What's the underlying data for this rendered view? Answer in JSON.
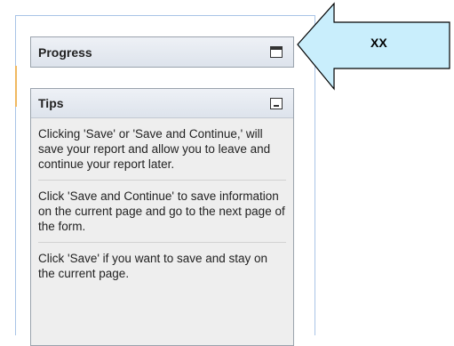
{
  "progress_panel": {
    "title": "Progress",
    "button_icon": "maximize-icon"
  },
  "tips_panel": {
    "title": "Tips",
    "button_icon": "minimize-icon",
    "tips": [
      "Clicking 'Save' or 'Save and Continue,' will save your report and allow you to leave and continue your report later.",
      "Click 'Save and Continue' to save information on the current page and go to the next page of the form.",
      "Click 'Save' if you want to save and stay on the current page."
    ]
  },
  "callout": {
    "label": "XX",
    "fill": "#c9eefc",
    "stroke": "#000000"
  }
}
